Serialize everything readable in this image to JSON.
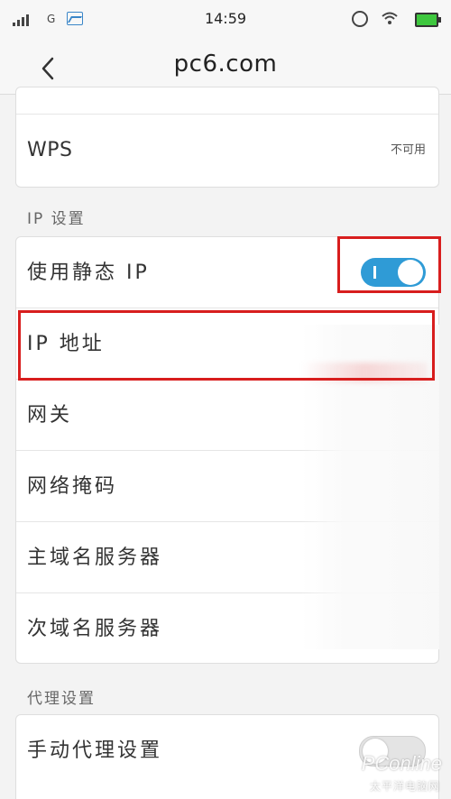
{
  "status_bar": {
    "network": "G",
    "time": "14:59"
  },
  "nav": {
    "title": "pc6.com"
  },
  "wps": {
    "label": "WPS",
    "value": "不可用"
  },
  "ip_settings": {
    "header": "IP 设置",
    "rows": [
      {
        "label": "使用静态 IP",
        "toggle": "on"
      },
      {
        "label": "IP 地址"
      },
      {
        "label": "网关"
      },
      {
        "label": "网络掩码"
      },
      {
        "label": "主域名服务器"
      },
      {
        "label": "次域名服务器"
      }
    ]
  },
  "proxy": {
    "header": "代理设置",
    "label": "手动代理设置",
    "toggle": "off"
  },
  "watermark": {
    "brand": "PConline",
    "sub": "太平洋电脑网"
  },
  "colors": {
    "toggle_on": "#2f9bd6",
    "highlight": "#d81e1e",
    "battery": "#3ec73e"
  }
}
